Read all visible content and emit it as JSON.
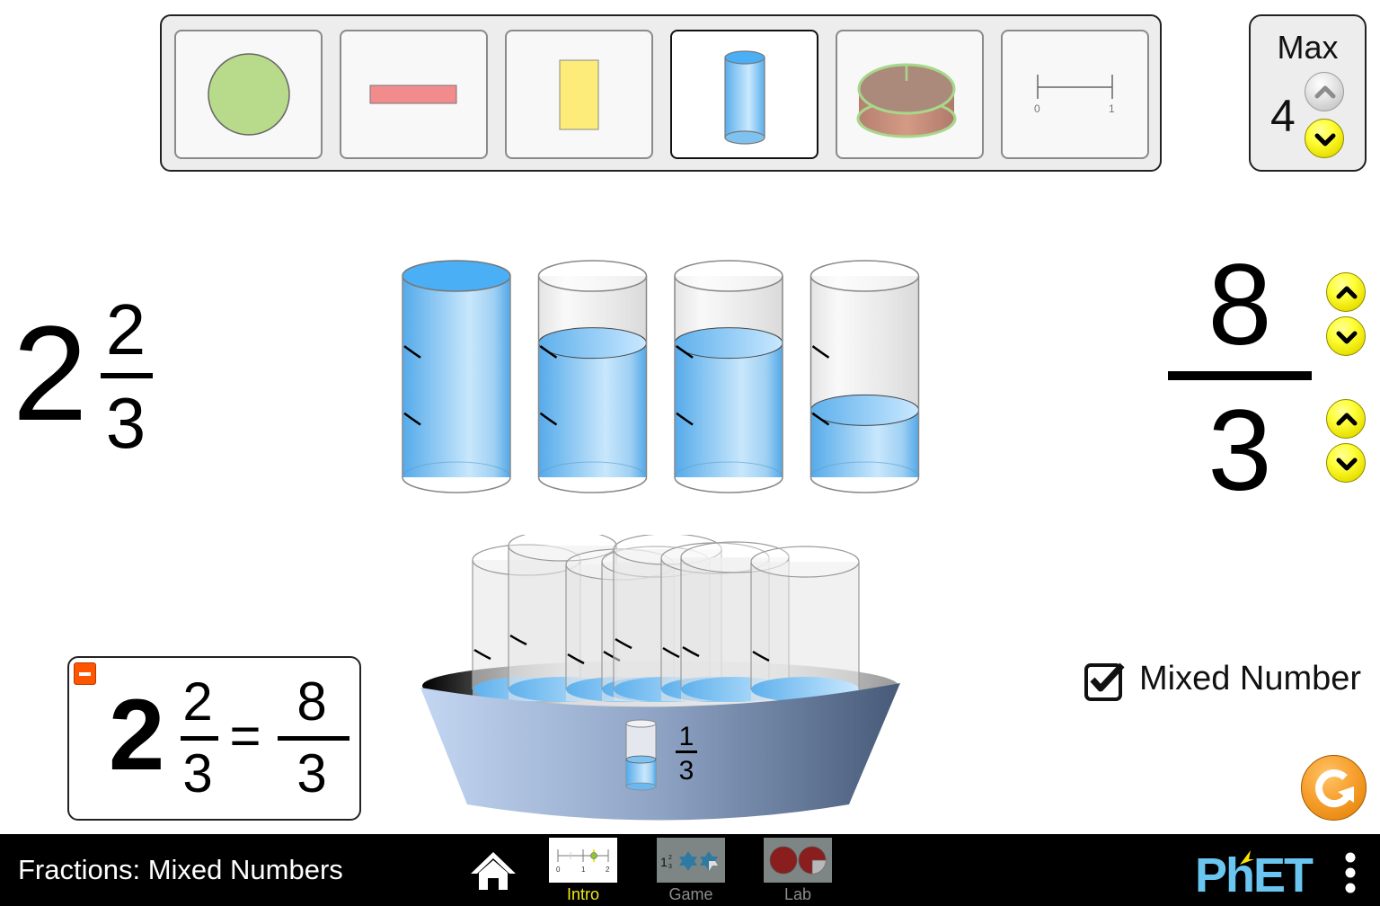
{
  "representations": {
    "items": [
      {
        "name": "circle",
        "selected": false
      },
      {
        "name": "horizontal-bar",
        "selected": false
      },
      {
        "name": "vertical-bar",
        "selected": false
      },
      {
        "name": "beaker",
        "selected": true
      },
      {
        "name": "cake",
        "selected": false
      },
      {
        "name": "number-line",
        "selected": false
      }
    ],
    "number_line_labels": [
      "0",
      "1"
    ]
  },
  "max_panel": {
    "label": "Max",
    "value": "4",
    "up_enabled": false,
    "down_enabled": true
  },
  "mixed_number": {
    "whole": "2",
    "numerator": "2",
    "denominator": "3"
  },
  "improper_fraction": {
    "numerator": "8",
    "denominator": "3"
  },
  "containers": {
    "fills_in_thirds": [
      3,
      2,
      2,
      1
    ],
    "divisions": 3
  },
  "bucket": {
    "piece_numerator": "1",
    "piece_denominator": "3"
  },
  "equation": {
    "whole": "2",
    "numerator": "2",
    "denominator": "3",
    "equals": "=",
    "rhs_numerator": "8",
    "rhs_denominator": "3"
  },
  "checkbox": {
    "label": "Mixed Number",
    "checked": true
  },
  "navbar": {
    "title": "Fractions: Mixed Numbers",
    "screens": [
      {
        "label": "Intro",
        "active": true
      },
      {
        "label": "Game",
        "active": false
      },
      {
        "label": "Lab",
        "active": false
      }
    ],
    "intro_thumb_labels": [
      "0",
      "1",
      "2"
    ],
    "game_thumb_text": "1",
    "brand": "PhET"
  },
  "colors": {
    "water": "#4aaff5",
    "active_tab": "#f2e916",
    "inactive_tab": "#8d8d8d",
    "reset": "#f7a030",
    "collapse": "#ff5500",
    "phet_blue": "#6ac6f0",
    "phet_yellow": "#fde400"
  }
}
